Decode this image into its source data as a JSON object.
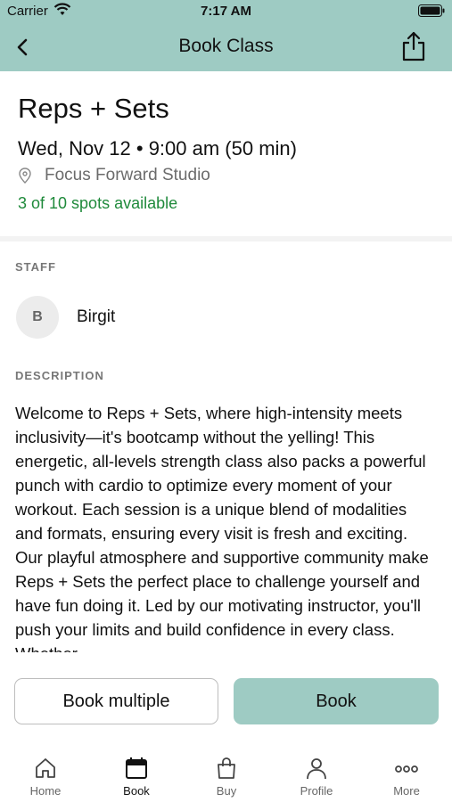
{
  "status_bar": {
    "carrier": "Carrier",
    "time": "7:17 AM"
  },
  "nav": {
    "title": "Book Class"
  },
  "class": {
    "title": "Reps + Sets",
    "datetime": "Wed, Nov 12 • 9:00 am (50 min)",
    "location": "Focus Forward Studio",
    "spots": "3 of 10 spots available"
  },
  "staff": {
    "heading": "STAFF",
    "initial": "B",
    "name": "Birgit"
  },
  "description": {
    "heading": "DESCRIPTION",
    "text": "Welcome to Reps + Sets, where high-intensity meets inclusivity—it's bootcamp without the yelling! This energetic, all-levels strength class also packs a powerful punch with cardio to optimize every moment of your workout. Each session is a unique blend of modalities and formats, ensuring every visit is fresh and exciting. Our playful atmosphere and supportive community make Reps + Sets the perfect place to challenge yourself and have fun doing it. Led by our motivating instructor, you'll push your limits and build confidence in every class. Whether"
  },
  "actions": {
    "book_multiple": "Book multiple",
    "book": "Book"
  },
  "tabbar": {
    "items": [
      {
        "label": "Home",
        "icon": "home-icon"
      },
      {
        "label": "Book",
        "icon": "calendar-icon"
      },
      {
        "label": "Buy",
        "icon": "shopping-bag-icon"
      },
      {
        "label": "Profile",
        "icon": "person-icon"
      },
      {
        "label": "More",
        "icon": "more-dots-icon"
      }
    ],
    "active": "Book"
  },
  "colors": {
    "accent": "#9ecbc3",
    "spots_available": "#1f8a3b"
  }
}
